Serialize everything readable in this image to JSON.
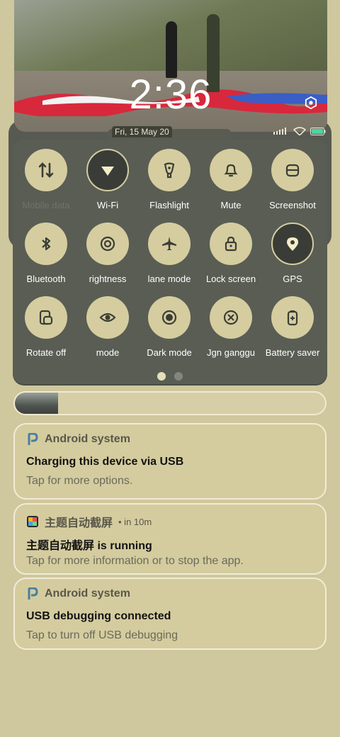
{
  "lockscreen": {
    "time": "2:36",
    "date": "Fri, 15 May 20"
  },
  "quick_settings": {
    "tiles": [
      {
        "label": "Mobile data",
        "icon": "data-arrows-icon",
        "active": false,
        "dim": true
      },
      {
        "label": "Wi-Fi",
        "icon": "wifi-icon",
        "active": true,
        "dim": false
      },
      {
        "label": "Flashlight",
        "icon": "flashlight-icon",
        "active": false,
        "dim": false
      },
      {
        "label": "Mute",
        "icon": "bell-icon",
        "active": false,
        "dim": false
      },
      {
        "label": "Screenshot",
        "icon": "screenshot-icon",
        "active": false,
        "dim": false
      },
      {
        "label": "Bluetooth",
        "icon": "bluetooth-icon",
        "active": false,
        "dim": false
      },
      {
        "label": "rightness",
        "icon": "brightness-icon",
        "active": false,
        "dim": false
      },
      {
        "label": "lane mode",
        "icon": "airplane-icon",
        "active": false,
        "dim": false
      },
      {
        "label": "Lock screen",
        "icon": "lock-icon",
        "active": false,
        "dim": false
      },
      {
        "label": "GPS",
        "icon": "location-pin-icon",
        "active": true,
        "dim": false
      },
      {
        "label": "Rotate off",
        "icon": "rotate-icon",
        "active": false,
        "dim": false
      },
      {
        "label": "mode",
        "icon": "eye-icon",
        "active": false,
        "dim": false
      },
      {
        "label": "Dark mode",
        "icon": "dark-mode-icon",
        "active": false,
        "dim": false
      },
      {
        "label": "Jgn ganggu",
        "icon": "do-not-disturb-icon",
        "active": false,
        "dim": false
      },
      {
        "label": "Battery saver",
        "icon": "battery-saver-icon",
        "active": false,
        "dim": false
      }
    ],
    "page_count": 2,
    "current_page": 1
  },
  "brightness": {
    "level": 0.14
  },
  "notifications": [
    {
      "app": "Android system",
      "meta": "",
      "title": "Charging this device via USB",
      "body": "Tap for more options."
    },
    {
      "app": "主题自动截屏",
      "meta": "• in 10m",
      "title": "主题自动截屏 is running",
      "body": "Tap for more information or to stop the app."
    },
    {
      "app": "Android system",
      "meta": "",
      "title": "USB debugging connected",
      "body": "Tap to turn off USB debugging"
    }
  ],
  "colors": {
    "background": "#cfc79d",
    "panel": "#595d54",
    "tile": "#d5cd9f",
    "accent_dark": "#3a3d37"
  }
}
